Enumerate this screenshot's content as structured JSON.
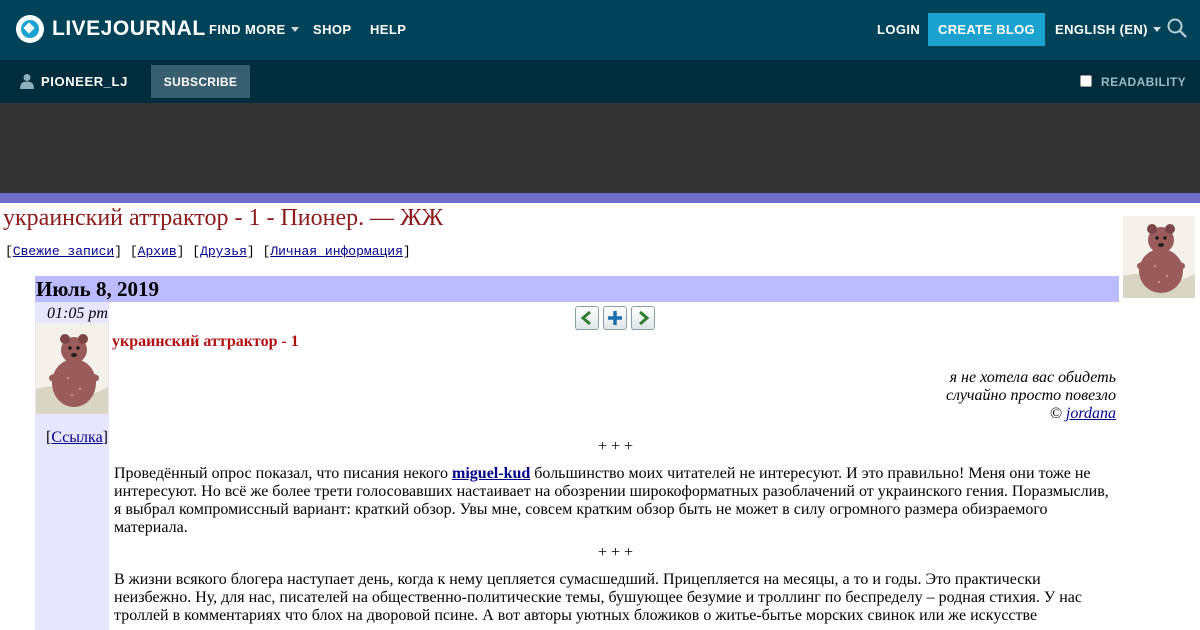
{
  "topnav": {
    "logo_text": "LIVEJOURNAL",
    "find_more": "FIND MORE",
    "shop": "SHOP",
    "help": "HELP",
    "login": "LOGIN",
    "create_blog": "CREATE BLOG",
    "language": "ENGLISH (EN)",
    "search_icon": "search-icon"
  },
  "subbar": {
    "username": "PIONEER_LJ",
    "subscribe": "SUBSCRIBE",
    "readability": "READABILITY"
  },
  "journal": {
    "title": "украинский аттрактор - 1 - Пионер. — ЖЖ",
    "nav": [
      "Свежие записи",
      "Архив",
      "Друзья",
      "Личная информация"
    ]
  },
  "entry": {
    "date": "Июль 8, 2019",
    "time": "01:05 pm",
    "link_label": "Ссылка",
    "title": "украинский аттрактор - 1",
    "quote_lines": [
      "я не хотела вас обидеть",
      "случайно просто повезло"
    ],
    "quote_copy": "©",
    "quote_author": "jordana",
    "separator": "+ + +",
    "para1_before": "Проведённый опрос показал, что писания некого ",
    "para1_link": "miguel-kud",
    "para1_after": " большинство моих читателей не интересуют. И это правильно! Меня они тоже не интересуют. Но всё же более трети голосовавших настаивает на обозрении широкоформатных разоблачений от украинского гения. Поразмыслив, я выбрал компромиссный вариант: краткий обзор. Увы мне, совсем кратким обзор быть не может в силу огромного размера обизраемого материала.",
    "para2": "В жизни всякого блогера наступает день, когда к нему цепляется сумасшедший. Прицепляется на месяцы, а то и годы. Это практически неизбежно. Ну, для нас, писателей на общественно-политические темы, бушующее безумие и троллинг по беспределу – родная стихия. У нас троллей в комментариях что блох на дворовой псине. А вот авторы уютных бложиков о житье-бытье морских свинок или же искусстве"
  },
  "colors": {
    "topbar": "#004359",
    "subbar": "#002d3d",
    "accent": "#1ba2cf",
    "date_bar": "#bbbbff",
    "title_red": "#8b1a1a"
  }
}
